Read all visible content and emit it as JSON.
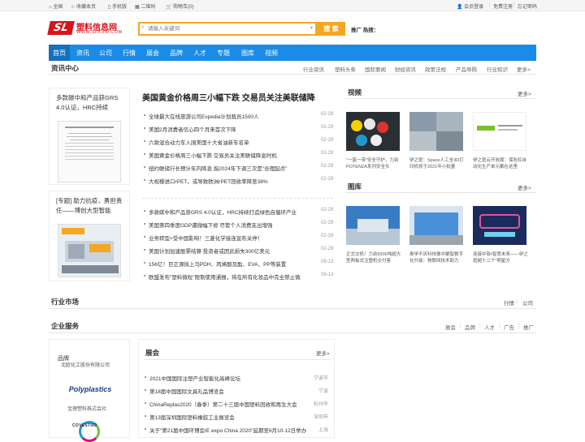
{
  "topbar": {
    "home": "全国",
    "bookmark": "收藏本页",
    "mobile": "手机版",
    "qrcode": "二维码",
    "cart": "购物车(0)",
    "login": "会员登录",
    "register": "免费注册",
    "forgot": "忘记密码"
  },
  "brand": {
    "logo_text": "塑料信息网",
    "logo_sub": "WWW.SLXXW.COM",
    "logo_mark": "SL"
  },
  "search": {
    "placeholder": "请输入关键词",
    "button": "搜 索",
    "hot_label": "推广 热搜："
  },
  "nav": [
    "首页",
    "资讯",
    "公司",
    "行情",
    "展会",
    "品牌",
    "人才",
    "专题",
    "图库",
    "视频"
  ],
  "news_center": {
    "title": "资讯中心",
    "sublinks": [
      "行业资讯",
      "塑料头条",
      "国际要闻",
      "财经资讯",
      "政策法规",
      "产品导购",
      "行业知识",
      "更多>"
    ]
  },
  "left_cards": [
    {
      "title": "多款碳中和产品获GRS 4.0认证，HRC持续"
    },
    {
      "title": "[专题] 助力抗疫，勇担责任——博创大型智能"
    }
  ],
  "headline": "美国黄金价格周三小幅下跌 交易员关注美联储降",
  "news_group1": [
    {
      "title": "全球最大在线旅游公司Expedia计划裁员1500人",
      "date": "02-29"
    },
    {
      "title": "美国2月消费者信心四个月来首次下降",
      "date": "02-29"
    },
    {
      "title": "六款混合动力车入围美国十大省油新车名单",
      "date": "02-29"
    },
    {
      "title": "美国黄金价格周三小幅下跌 交易员关注美联储降息时机",
      "date": "02-29"
    },
    {
      "title": "纽约联储行长预计年内降息 指2024年下调三次是\"合理起点\"",
      "date": "02-29"
    },
    {
      "title": "大视檬进口rPET，或导致欧洲rPET回收率降至38%",
      "date": "02-29"
    }
  ],
  "news_group2": [
    {
      "title": "多款碳中和产品获GRS 4.0认证，HRC持续打造绿色自循环产业",
      "date": "02-29"
    },
    {
      "title": "美国第四季度GDP遭微幅下修 尽管个人消费支出增强",
      "date": "02-29"
    },
    {
      "title": "业务转型+受中国影响！三菱化学接连宣布关停！",
      "date": "02-29"
    },
    {
      "title": "美国计划加速股票结算 投资者或因此损失300亿美元",
      "date": "02-29"
    },
    {
      "title": "156亿！巨正源拟上马PDH、丙烯酸及酯、EVA、PP等装置",
      "date": "09-13"
    },
    {
      "title": "欧盟发布\"塑料微粒\"限制使用通报，将在所有化妆品中完全禁止微",
      "date": "09-13"
    }
  ],
  "video": {
    "title": "视频",
    "more": "更多>",
    "items": [
      {
        "caption": "\"一盔一带\"安全守护，力劲POTENZA系列安全头"
      },
      {
        "caption": "伊之密：Space人工全3D打印机将于2021年小批量"
      },
      {
        "caption": "伊之密云开放周：保险杠自动化生产单元都在这里"
      }
    ]
  },
  "gallery": {
    "title": "图库",
    "more": "更多>",
    "items": [
      {
        "caption": "正式交机！力劲6000吨超大型两板式注塑机交付客"
      },
      {
        "caption": "奥学不厌科技展中聚智数字化升级：物联网技术助力"
      },
      {
        "caption": "连接中软•智慧未来——伊之密超十二个\"明星方"
      }
    ]
  },
  "market": {
    "title": "行业市场",
    "links": [
      "行情",
      "公司"
    ]
  },
  "enterprise": {
    "title": "企业服务",
    "links": [
      "展会",
      "品牌",
      "人才",
      "广告",
      "推广"
    ]
  },
  "brands": {
    "title": "品牌",
    "items": [
      "北欧化工股份有限公司",
      "宝理塑料株式会社"
    ],
    "logo2_text": "Polyplastics",
    "logo3_text": "COVESTRO"
  },
  "expo": {
    "title": "展会",
    "more": "更多>",
    "items": [
      {
        "title": "2021中国国际注塑产业智能化高峰论坛",
        "city": "宁波市"
      },
      {
        "title": "第18届中国国际文具礼品博览会",
        "city": "宁波"
      },
      {
        "title": "ChinaReplas2020（春季）第二十三届中国塑料回收和再生大会",
        "city": "杭州市"
      },
      {
        "title": "第13届深圳国际塑料橡胶工业展览会",
        "city": "深圳市"
      },
      {
        "title": "关于\"第21届中国环博会IE expo China 2020\"延期至6月10-12日举办",
        "city": "上海"
      }
    ]
  },
  "colors": {
    "nav": "#1a8be6",
    "nav_active": "#1570bd",
    "accent": "#f5a623",
    "logo_red": "#d7141a"
  }
}
